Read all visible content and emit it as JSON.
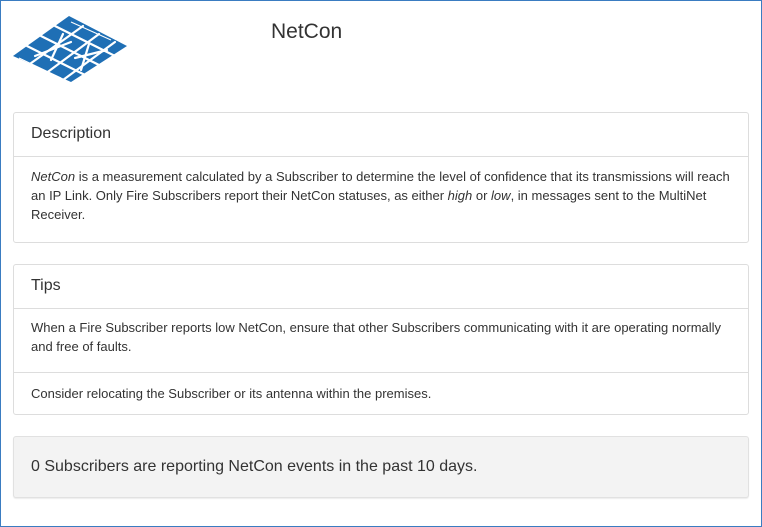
{
  "app": {
    "title": "NetCon",
    "logo_icon": "multinet-grid-logo-icon",
    "brand_color": "#1f6fb5"
  },
  "description": {
    "heading": "Description",
    "term": "NetCon",
    "text_1": " is a measurement calculated by a Subscriber to determine the level of confidence that its transmissions will reach an IP Link. Only Fire Subscribers report their NetCon statuses, as either ",
    "high": "high",
    "or": " or ",
    "low": "low",
    "text_2": ", in messages sent to the MultiNet Receiver."
  },
  "tips": {
    "heading": "Tips",
    "items": [
      "When a Fire Subscriber reports low NetCon, ensure that other Subscribers communicating with it are operating normally and free of faults.",
      "Consider relocating the Subscriber or its antenna within the premises."
    ]
  },
  "status": {
    "message": "0 Subscribers are reporting NetCon events in the past 10 days."
  }
}
